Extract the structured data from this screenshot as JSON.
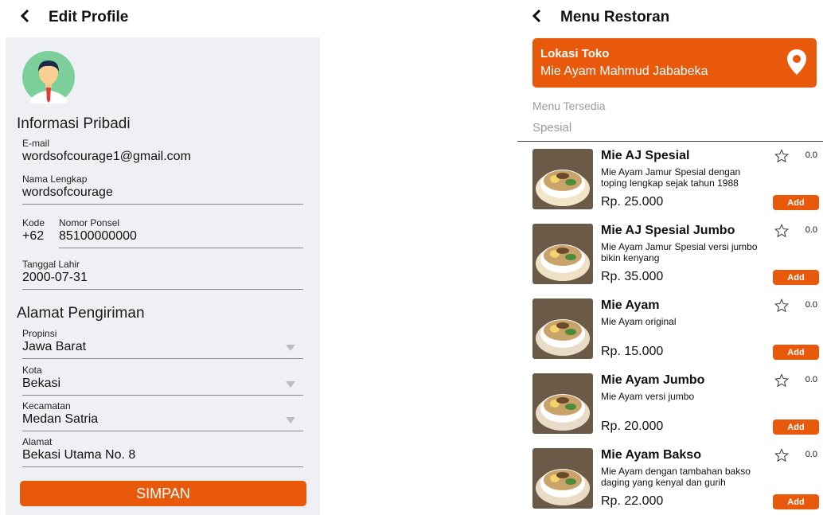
{
  "edit_profile": {
    "back_icon": "back-chevron-icon",
    "title": "Edit Profile",
    "section_personal": "Informasi Pribadi",
    "email": {
      "label": "E-mail",
      "value": "wordsofcourage1@gmail.com"
    },
    "full_name": {
      "label": "Nama Lengkap",
      "value": "wordsofcourage"
    },
    "phone": {
      "code_label": "Kode",
      "code_value": "+62",
      "number_label": "Nomor Ponsel",
      "number_value": "85100000000"
    },
    "birth_date": {
      "label": "Tanggal Lahir",
      "value": "2000-07-31"
    },
    "section_address": "Alamat Pengiriman",
    "province": {
      "label": "Propinsi",
      "value": "Jawa Barat"
    },
    "city": {
      "label": "Kota",
      "value": "Bekasi"
    },
    "district": {
      "label": "Kecamatan",
      "value": "Medan Satria"
    },
    "address": {
      "label": "Alamat",
      "value": "Bekasi Utama No. 8"
    },
    "save_label": "SIMPAN"
  },
  "menu": {
    "back_icon": "back-chevron-icon",
    "title": "Menu Restoran",
    "location": {
      "label": "Lokasi Toko",
      "name": "Mie Ayam Mahmud Jababeka",
      "icon": "map-pin-icon"
    },
    "available_label": "Menu Tersedia",
    "category_label": "Spesial",
    "items": [
      {
        "name": "Mie AJ Spesial",
        "desc": "Mie Ayam Jamur Spesial dengan toping lengkap sejak tahun 1988",
        "price": "Rp. 25.000",
        "rating": "0.0",
        "add": "Add"
      },
      {
        "name": "Mie AJ Spesial Jumbo",
        "desc": "Mie Ayam Jamur Spesial versi jumbo bikin kenyang",
        "price": "Rp. 35.000",
        "rating": "0.0",
        "add": "Add"
      },
      {
        "name": "Mie Ayam",
        "desc": "Mie Ayam original",
        "price": "Rp. 15.000",
        "rating": "0.0",
        "add": "Add"
      },
      {
        "name": "Mie Ayam Jumbo",
        "desc": "Mie Ayam versi jumbo",
        "price": "Rp. 20.000",
        "rating": "0.0",
        "add": "Add"
      },
      {
        "name": "Mie Ayam Bakso",
        "desc": "Mie Ayam dengan tambahan bakso daging yang kenyal dan gurih",
        "price": "Rp. 22.000",
        "rating": "0.0",
        "add": "Add"
      }
    ]
  },
  "colors": {
    "accent": "#e8590c",
    "panel": "#eef0f3",
    "muted": "#9a9a9a"
  }
}
